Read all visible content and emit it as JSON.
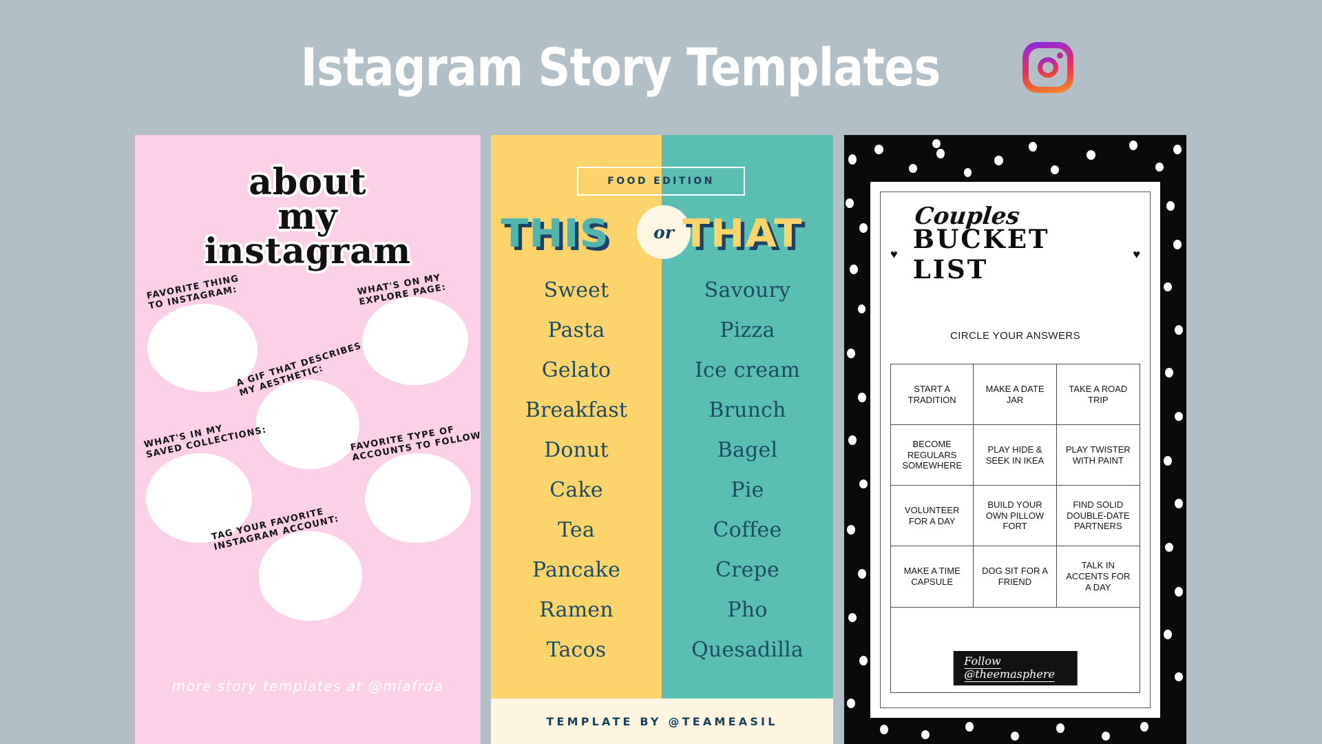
{
  "header": {
    "title": "Istagram Story Templates",
    "logo_icon": "instagram-icon"
  },
  "colors": {
    "page_background": "#b2bfc6",
    "pink_card": "#fcd0e6",
    "yellow_panel": "#fdd36c",
    "teal_panel": "#5bbeb2",
    "navy_text": "#17405f",
    "cream_footer": "#fdf5e0",
    "black_card": "#0a0a0a"
  },
  "card_about": {
    "title_line1": "about",
    "title_line2": "my",
    "title_line3": "instagram",
    "prompts": [
      "FAVORITE THING\nTO INSTAGRAM:",
      "WHAT'S ON MY\nEXPLORE PAGE:",
      "A GIF THAT DESCRIBES\nMY AESTHETIC:",
      "WHAT'S IN MY\nSAVED COLLECTIONS:",
      "FAVORITE TYPE OF\nACCOUNTS TO FOLLOW:",
      "TAG YOUR FAVORITE\nINSTAGRAM ACCOUNT:"
    ],
    "prompt_1_line1": "FAVORITE THING",
    "prompt_1_line2": "TO INSTAGRAM:",
    "prompt_2_line1": "WHAT'S ON MY",
    "prompt_2_line2": "EXPLORE PAGE:",
    "prompt_3_line1": "A GIF THAT DESCRIBES",
    "prompt_3_line2": "MY AESTHETIC:",
    "prompt_4_line1": "WHAT'S IN MY",
    "prompt_4_line2": "SAVED COLLECTIONS:",
    "prompt_5_line1": "FAVORITE TYPE OF",
    "prompt_5_line2": "ACCOUNTS TO FOLLOW:",
    "prompt_6_line1": "TAG YOUR FAVORITE",
    "prompt_6_line2": "INSTAGRAM ACCOUNT:",
    "footer": "more story templates at @miafrda"
  },
  "card_thisthat": {
    "edition_label": "FOOD EDITION",
    "this_label": "THIS",
    "or_label": "or",
    "that_label": "THAT",
    "pairs": [
      {
        "this": "Sweet",
        "that": "Savoury"
      },
      {
        "this": "Pasta",
        "that": "Pizza"
      },
      {
        "this": "Gelato",
        "that": "Ice cream"
      },
      {
        "this": "Breakfast",
        "that": "Brunch"
      },
      {
        "this": "Donut",
        "that": "Bagel"
      },
      {
        "this": "Cake",
        "that": "Pie"
      },
      {
        "this": "Tea",
        "that": "Coffee"
      },
      {
        "this": "Pancake",
        "that": "Crepe"
      },
      {
        "this": "Ramen",
        "that": "Pho"
      },
      {
        "this": "Tacos",
        "that": "Quesadilla"
      }
    ],
    "footer": "TEMPLATE BY @TEAMEASIL"
  },
  "card_bucket": {
    "script_word": "Couples",
    "title": "BUCKET LIST",
    "heart_icon": "♥",
    "subtitle": "CIRCLE YOUR ANSWERS",
    "cells": [
      "START A\nTRADITION",
      "MAKE A DATE\nJAR",
      "TAKE A ROAD\nTRIP",
      "BECOME\nREGULARS\nSOMEWHERE",
      "PLAY HIDE &\nSEEK IN IKEA",
      "PLAY TWISTER\nWITH PAINT",
      "VOLUNTEER\nFOR A DAY",
      "BUILD YOUR\nOWN PILLOW\nFORT",
      "FIND SOLID\nDOUBLE-DATE\nPARTNERS",
      "MAKE A TIME\nCAPSULE",
      "DOG SIT FOR A\nFRIEND",
      "TALK IN\nACCENTS FOR\nA DAY"
    ],
    "follow_label": "Follow @theemasphere"
  }
}
